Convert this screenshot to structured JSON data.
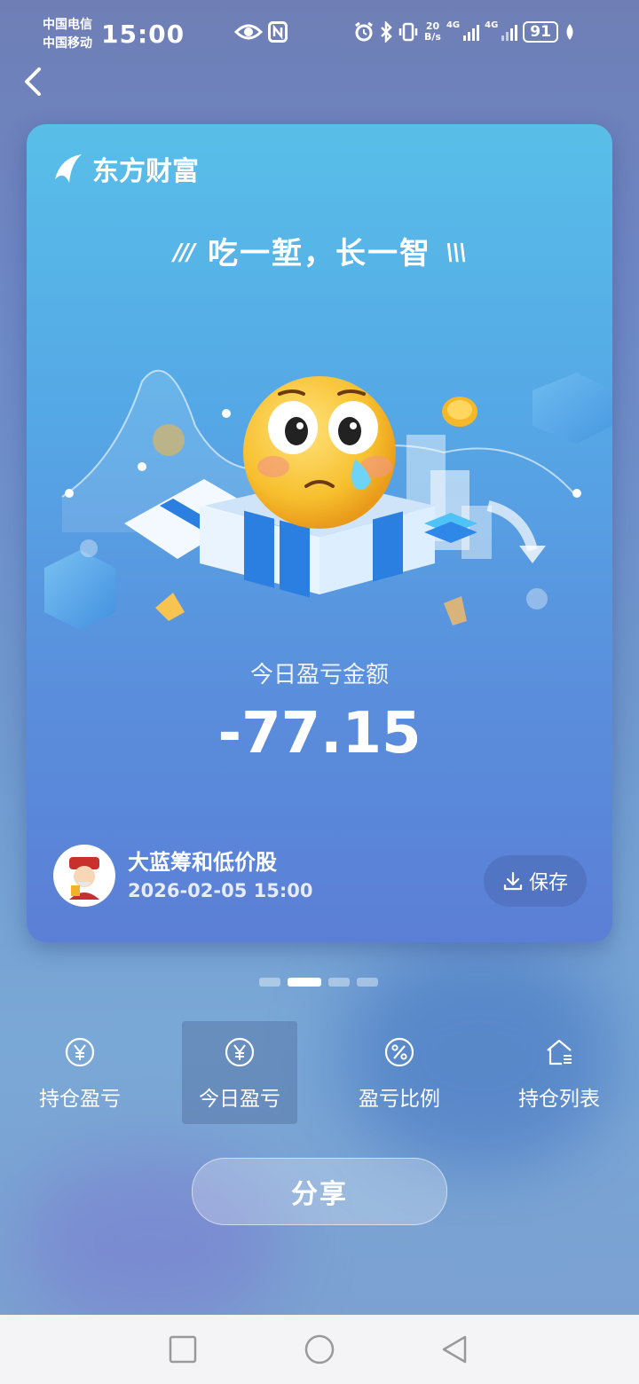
{
  "status_bar": {
    "carrier_1": "中国电信",
    "carrier_2": "中国移动",
    "time": "15:00",
    "net_speed_value": "20",
    "net_speed_unit": "B/s",
    "signal_1_label": "4G",
    "signal_2_label": "4G",
    "battery": "91"
  },
  "card": {
    "brand": "东方财富",
    "slogan": "吃一堑，长一智",
    "pnl_label": "今日盈亏金额",
    "pnl_value": "-77.15",
    "user_name": "大蓝筹和低价股",
    "datetime": "2026-02-05 15:00",
    "save_label": "保存"
  },
  "pager": {
    "count": 4,
    "active_index": 1
  },
  "tabs": [
    {
      "label": "持仓盈亏",
      "icon": "yen-circle-icon",
      "active": false
    },
    {
      "label": "今日盈亏",
      "icon": "yen-circle-icon",
      "active": true
    },
    {
      "label": "盈亏比例",
      "icon": "percent-circle-icon",
      "active": false
    },
    {
      "label": "持仓列表",
      "icon": "house-list-icon",
      "active": false
    }
  ],
  "share_label": "分享",
  "colors": {
    "card_top": "#58bfe8",
    "card_bottom": "#5b7fd6",
    "accent_white": "#ffffff"
  }
}
